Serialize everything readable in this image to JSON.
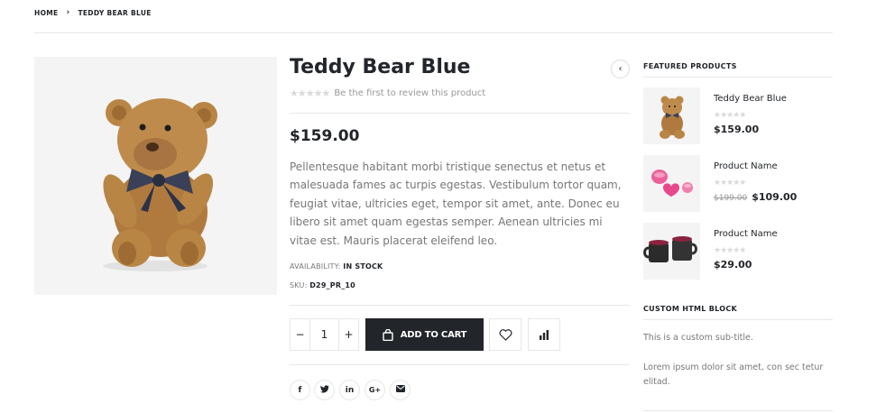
{
  "breadcrumb": {
    "home": "HOME",
    "current": "TEDDY BEAR BLUE"
  },
  "product": {
    "title": "Teddy Bear Blue",
    "review_text": "Be the first to review this product",
    "price": "$159.00",
    "description": "Pellentesque habitant morbi tristique senectus et netus et malesuada fames ac turpis egestas. Vestibulum tortor quam, feugiat vitae, ultricies eget, tempor sit amet, ante. Donec eu libero sit amet quam egestas semper. Aenean ultricies mi vitae est. Mauris placerat eleifend leo.",
    "availability_label": "AVAILABILITY:",
    "availability_value": "IN STOCK",
    "sku_label": "SKU:",
    "sku_value": "D29_PR_10",
    "quantity": "1",
    "add_to_cart": "ADD TO CART",
    "rating": 0
  },
  "share": [
    {
      "name": "facebook-icon",
      "glyph": "f"
    },
    {
      "name": "twitter-icon",
      "glyph": "t"
    },
    {
      "name": "linkedin-icon",
      "glyph": "in"
    },
    {
      "name": "google-plus-icon",
      "glyph": "G+"
    },
    {
      "name": "email-icon",
      "glyph": "✉"
    }
  ],
  "sidebar": {
    "featured_title": "FEATURED PRODUCTS",
    "featured": [
      {
        "name": "Teddy Bear Blue",
        "price": "$159.00",
        "old_price": ""
      },
      {
        "name": "Product Name",
        "price": "$109.00",
        "old_price": "$199.00"
      },
      {
        "name": "Product Name",
        "price": "$29.00",
        "old_price": ""
      }
    ],
    "custom_title": "CUSTOM HTML BLOCK",
    "custom_subtitle": "This is a custom sub-title.",
    "custom_text": "Lorem ipsum dolor sit amet, con sec tetur elitad."
  },
  "colors": {
    "dark": "#222529",
    "muted": "#777777",
    "border": "#e7e7e7"
  }
}
